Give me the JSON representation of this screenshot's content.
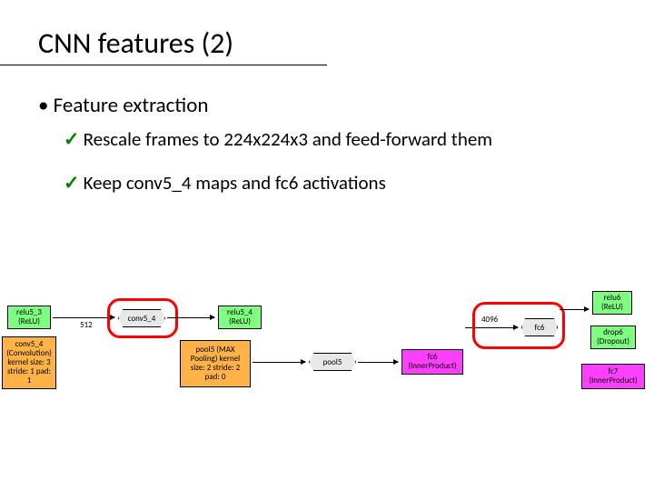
{
  "title": "CNN features (2)",
  "bullet": "Feature extraction",
  "sub1": "Rescale frames to 224x224x3 and feed-forward them",
  "sub2": "Keep conv5_4 maps and fc6 activations",
  "nodes": {
    "relu53": "relu5_3\n(ReLU)",
    "conv54_box": "conv5_4\n(Convolution)\nkernel size: 3\nstride: 1\npad: 1",
    "conv54_hex": "conv5_4",
    "relu54": "relu5_4\n(ReLU)",
    "pool5_box": "pool5\n(MAX Pooling)\nkernel size: 2\nstride: 2\npad: 0",
    "pool5_hex": "pool5",
    "fc6_box": "fc6\n(InnerProduct)",
    "fc6_hex": "fc6",
    "relu6": "relu6\n(ReLU)",
    "drop6": "drop6\n(Dropout)",
    "fc7_box": "fc7\n(InnerProduct)"
  },
  "labels": {
    "n512": "512",
    "n4096": "4096"
  }
}
